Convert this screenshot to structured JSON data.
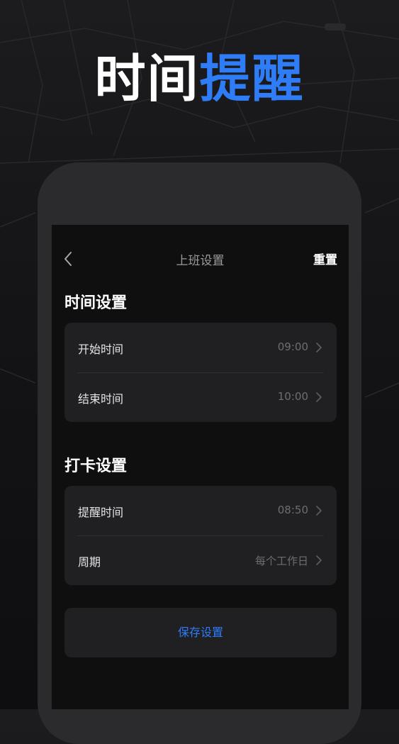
{
  "promo": {
    "title_white": "时间",
    "title_blue": "提醒"
  },
  "nav": {
    "back_icon": "chevron-left-icon",
    "title": "上班设置",
    "reset_label": "重置"
  },
  "time_section": {
    "title": "时间设置",
    "rows": [
      {
        "label": "开始时间",
        "value": "09:00"
      },
      {
        "label": "结束时间",
        "value": "10:00"
      }
    ]
  },
  "checkin_section": {
    "title": "打卡设置",
    "rows": [
      {
        "label": "提醒时间",
        "value": "08:50"
      },
      {
        "label": "周期",
        "value": "每个工作日"
      }
    ]
  },
  "save_label": "保存设置",
  "colors": {
    "accent": "#2e7cf6",
    "background": "#0f0f10",
    "card": "#202022",
    "phone_frame": "#2b2b2d"
  }
}
